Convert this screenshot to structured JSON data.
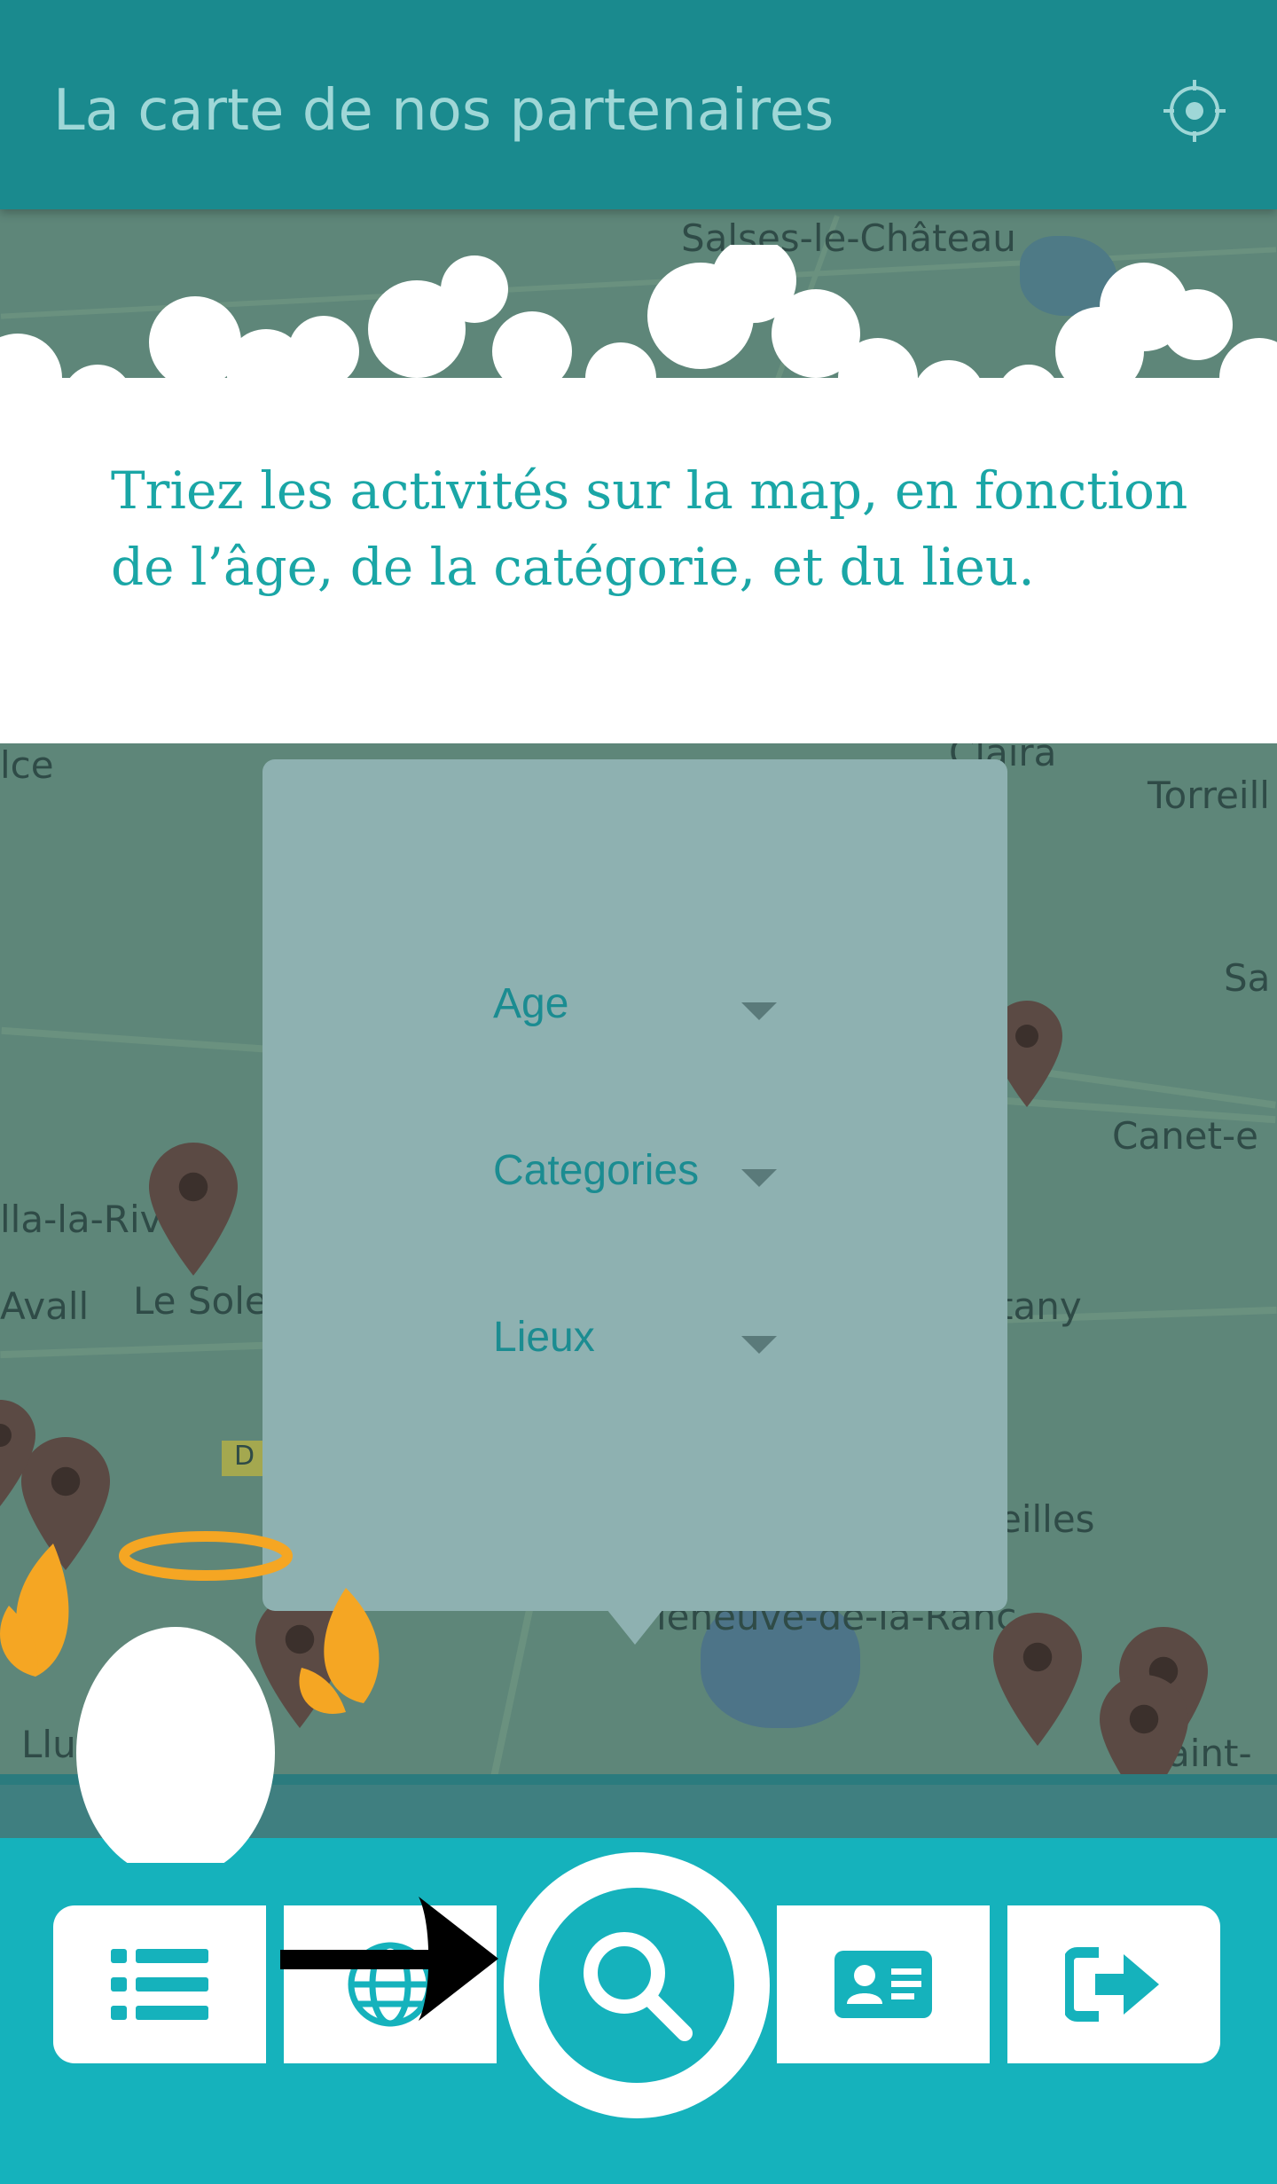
{
  "header": {
    "title": "La carte de nos partenaires",
    "locate_icon": "crosshair-locate-icon"
  },
  "map_top": {
    "labels": [
      "Salses-le-Château"
    ]
  },
  "tutorial": {
    "text": "Triez les activités sur la map, en fonction de l’âge, de la catégorie, et du lieu."
  },
  "map_main": {
    "labels": [
      "lce",
      "Claira",
      "Torreill",
      "Sa",
      "Canet-e",
      "lla-la-Riv",
      "Le Sole",
      "Avall",
      "tany",
      "eilles",
      "leneuve-de-la-Ranc",
      "aint-",
      "Llu",
      "D"
    ]
  },
  "filters": [
    {
      "label": "Age"
    },
    {
      "label": "Categories"
    },
    {
      "label": "Lieux"
    }
  ],
  "nav": {
    "items": [
      {
        "name": "list",
        "icon": "list-icon"
      },
      {
        "name": "globe",
        "icon": "globe-icon"
      },
      {
        "name": "search",
        "icon": "search-icon"
      },
      {
        "name": "contact",
        "icon": "contact-card-icon"
      },
      {
        "name": "logout",
        "icon": "logout-icon"
      }
    ]
  },
  "colors": {
    "header": "#1a8a8e",
    "accent": "#15b2bc",
    "text_teal": "#1aa6a6",
    "popup": "#8eb1b1",
    "mascot_wings": "#f5a623"
  }
}
